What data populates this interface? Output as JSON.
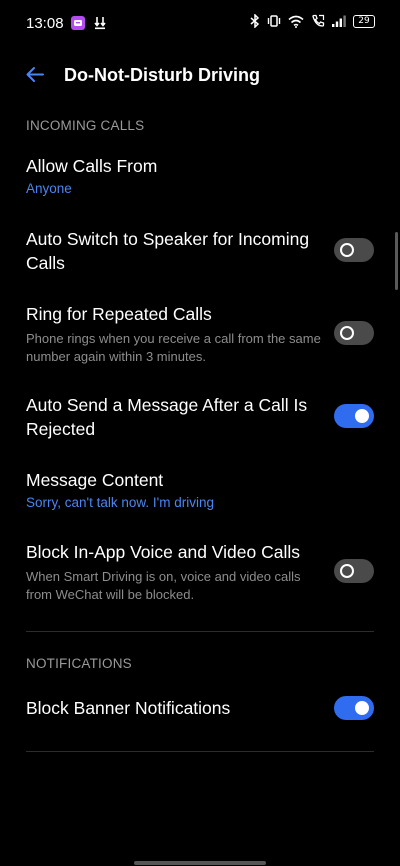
{
  "status_bar": {
    "time": "13:08",
    "battery": "29",
    "icons": [
      "app-notification-icon",
      "download-icon",
      "bluetooth-icon",
      "vibrate-icon",
      "wifi-icon",
      "call-icon",
      "signal-icon",
      "battery-icon"
    ]
  },
  "header": {
    "title": "Do-Not-Disturb Driving"
  },
  "incoming_calls": {
    "section_label": "INCOMING CALLS",
    "allow_calls_from": {
      "title": "Allow Calls From",
      "value": "Anyone"
    },
    "auto_switch_speaker": {
      "title": "Auto Switch to Speaker for Incoming Calls",
      "enabled": false
    },
    "ring_repeated": {
      "title": "Ring for Repeated Calls",
      "description": "Phone rings when you receive a call from the same number again within 3 minutes.",
      "enabled": false
    },
    "auto_send_message": {
      "title": "Auto Send a Message After a Call Is Rejected",
      "enabled": true
    },
    "message_content": {
      "title": "Message Content",
      "value": "Sorry, can't talk now. I'm driving"
    },
    "block_voice_video": {
      "title": "Block In-App Voice and Video Calls",
      "description": "When Smart Driving is on, voice and video calls from WeChat will be blocked.",
      "enabled": false
    }
  },
  "notifications": {
    "section_label": "NOTIFICATIONS",
    "block_banner": {
      "title": "Block Banner Notifications",
      "enabled": true
    }
  },
  "colors": {
    "accent": "#4a86f0",
    "toggle_on": "#2f6cf0",
    "toggle_off": "#4a4a4a",
    "background": "#000000"
  }
}
